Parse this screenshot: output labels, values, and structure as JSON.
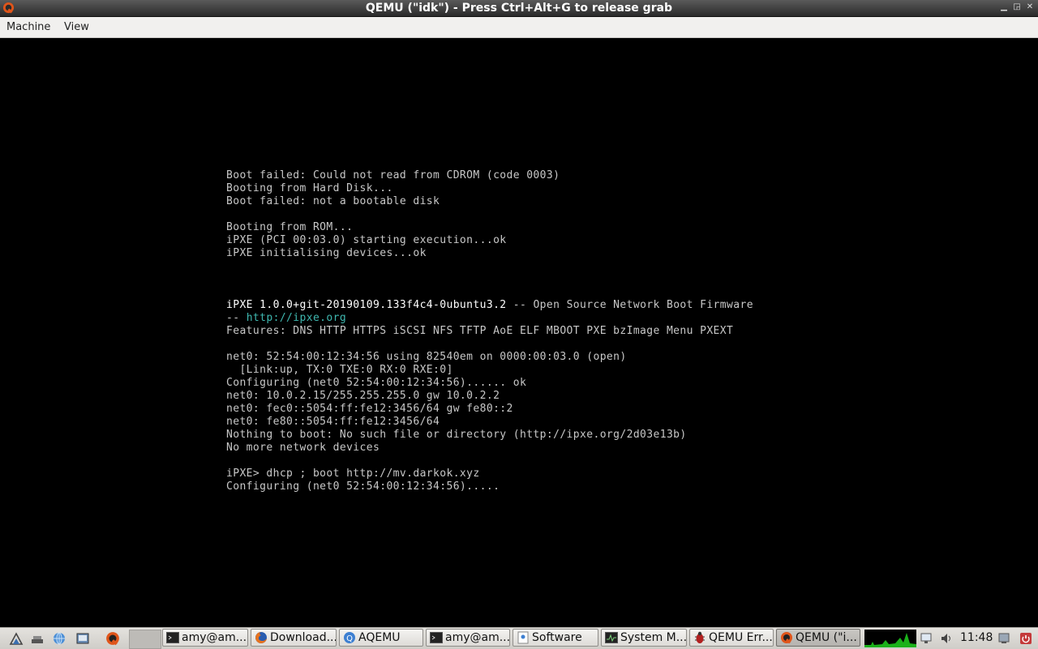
{
  "window": {
    "title": "QEMU (\"idk\") - Press Ctrl+Alt+G to release grab",
    "minimize_glyph": "▁",
    "maximize_glyph": "◲",
    "close_glyph": "✕"
  },
  "menu": {
    "items": [
      {
        "label": "Machine"
      },
      {
        "label": "View"
      }
    ]
  },
  "console": {
    "lines": [
      {
        "text": "Boot failed: Could not read from CDROM (code 0003)"
      },
      {
        "text": "Booting from Hard Disk..."
      },
      {
        "text": "Boot failed: not a bootable disk"
      },
      {
        "text": ""
      },
      {
        "text": "Booting from ROM..."
      },
      {
        "text": "iPXE (PCI 00:03.0) starting execution...ok"
      },
      {
        "text": "iPXE initialising devices...ok"
      },
      {
        "text": ""
      },
      {
        "text": ""
      },
      {
        "text": ""
      },
      {
        "text": "iPXE 1.0.0+git-20190109.133f4c4-0ubuntu3.2",
        "style": "bright",
        "suffix": " -- Open Source Network Boot Firmware"
      },
      {
        "text": "-- ",
        "link": "http://ipxe.org"
      },
      {
        "text": "Features: DNS HTTP HTTPS iSCSI NFS TFTP AoE ELF MBOOT PXE bzImage Menu PXEXT"
      },
      {
        "text": ""
      },
      {
        "text": "net0: 52:54:00:12:34:56 using 82540em on 0000:00:03.0 (open)"
      },
      {
        "text": "  [Link:up, TX:0 TXE:0 RX:0 RXE:0]"
      },
      {
        "text": "Configuring (net0 52:54:00:12:34:56)...... ok"
      },
      {
        "text": "net0: 10.0.2.15/255.255.255.0 gw 10.0.2.2"
      },
      {
        "text": "net0: fec0::5054:ff:fe12:3456/64 gw fe80::2"
      },
      {
        "text": "net0: fe80::5054:ff:fe12:3456/64"
      },
      {
        "text": "Nothing to boot: No such file or directory (http://ipxe.org/2d03e13b)"
      },
      {
        "text": "No more network devices"
      },
      {
        "text": ""
      },
      {
        "text": "iPXE> dhcp ; boot http://mv.darkok.xyz"
      },
      {
        "text": "Configuring (net0 52:54:00:12:34:56)....."
      }
    ]
  },
  "taskbar": {
    "launchers": [
      {
        "icon": "menu-icon"
      },
      {
        "icon": "show-desktop-icon"
      },
      {
        "icon": "network-globe-icon"
      },
      {
        "icon": "file-manager-icon"
      },
      {
        "icon": "terminal-icon"
      },
      {
        "icon": "qemu-icon"
      }
    ],
    "tasks": [
      {
        "label": "amy@am...",
        "icon": "terminal-icon",
        "active": false
      },
      {
        "label": "Download...",
        "icon": "firefox-icon",
        "active": false
      },
      {
        "label": "AQEMU",
        "icon": "aqemu-icon",
        "active": false
      },
      {
        "label": "amy@am...",
        "icon": "terminal-icon",
        "active": false
      },
      {
        "label": "Software",
        "icon": "software-icon",
        "active": false
      },
      {
        "label": "System M...",
        "icon": "system-monitor-icon",
        "active": false
      },
      {
        "label": "QEMU Err...",
        "icon": "bug-icon",
        "active": false
      },
      {
        "label": "QEMU (\"i...",
        "icon": "qemu-icon",
        "active": true
      }
    ],
    "clock": "11:48",
    "accent_colors": {
      "qemu": "#e0551a",
      "firefox": "#e8731e",
      "cpu_graph": "#1fd01f"
    }
  }
}
